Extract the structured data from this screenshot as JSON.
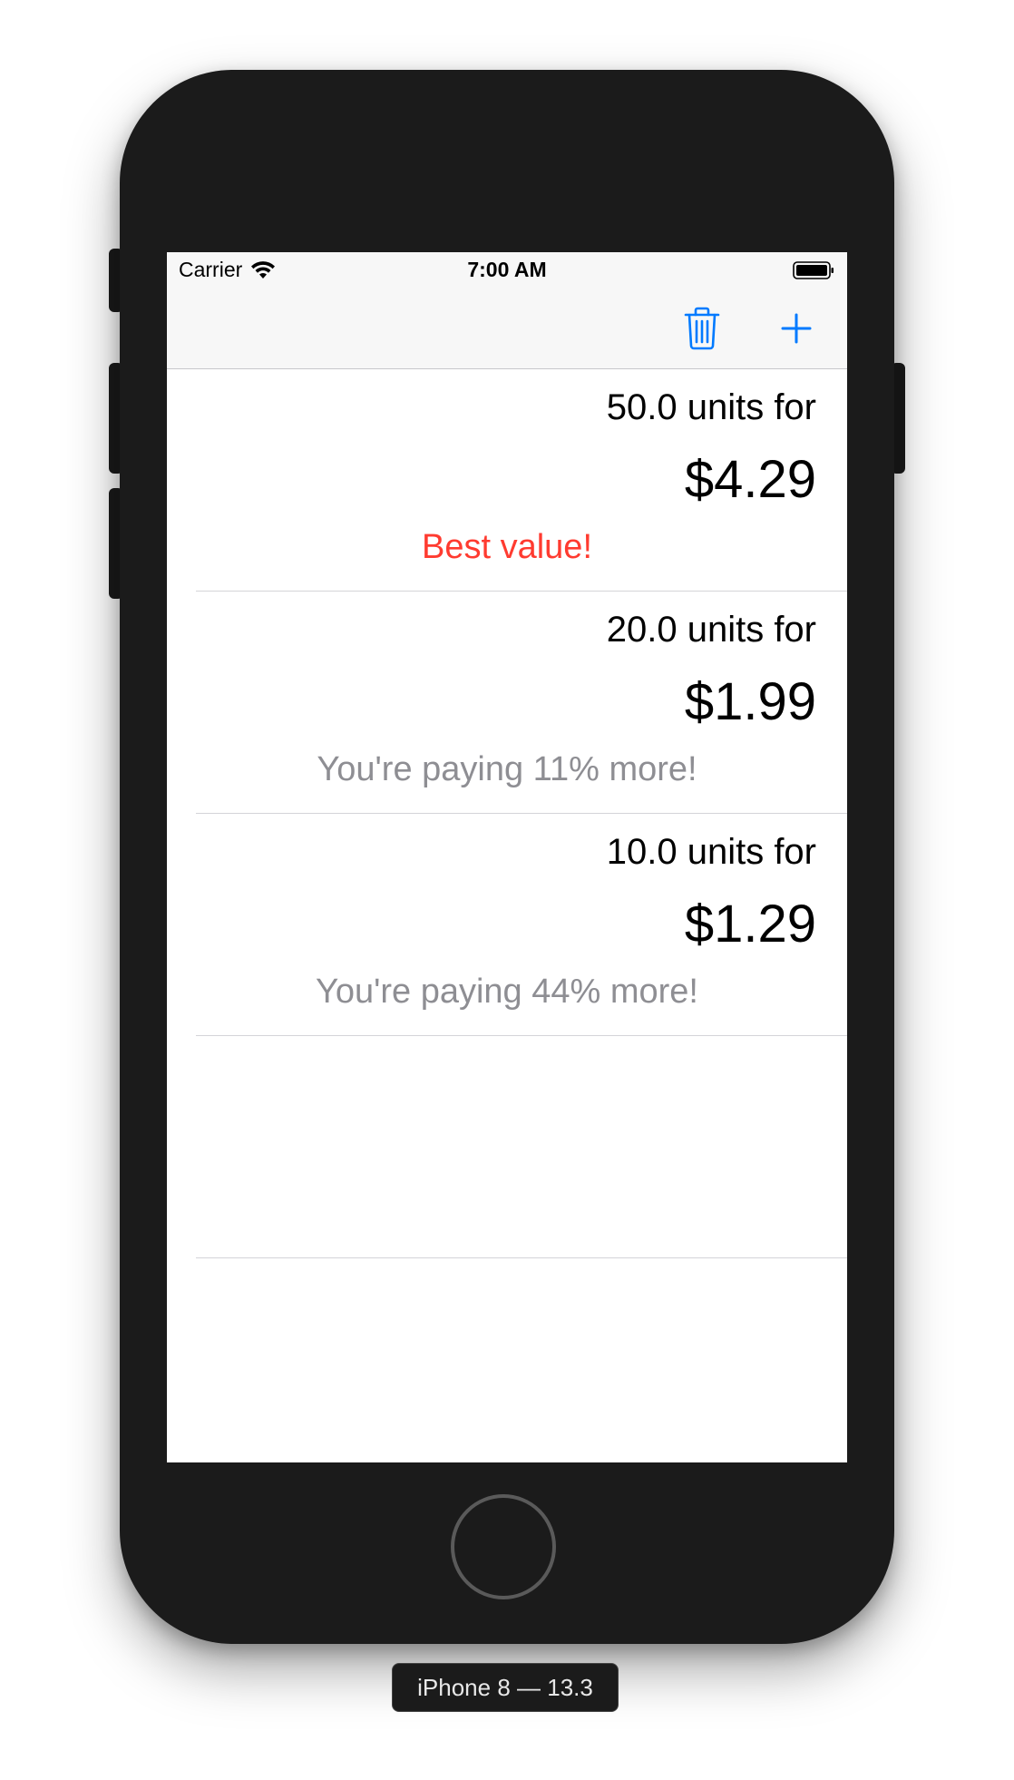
{
  "status_bar": {
    "carrier": "Carrier",
    "time": "7:00 AM"
  },
  "nav_bar": {
    "trash_icon": "trash-icon",
    "add_icon": "plus-icon",
    "accent_color": "#007aff"
  },
  "items": [
    {
      "units": "50.0 units for",
      "price": "$4.29",
      "note": "Best value!",
      "note_color": "#ff3b30"
    },
    {
      "units": "20.0 units for",
      "price": "$1.99",
      "note": "You're paying 11% more!",
      "note_color": "#8e8e93"
    },
    {
      "units": "10.0 units for",
      "price": "$1.29",
      "note": "You're paying 44% more!",
      "note_color": "#8e8e93"
    }
  ],
  "device_label": "iPhone 8 — 13.3"
}
